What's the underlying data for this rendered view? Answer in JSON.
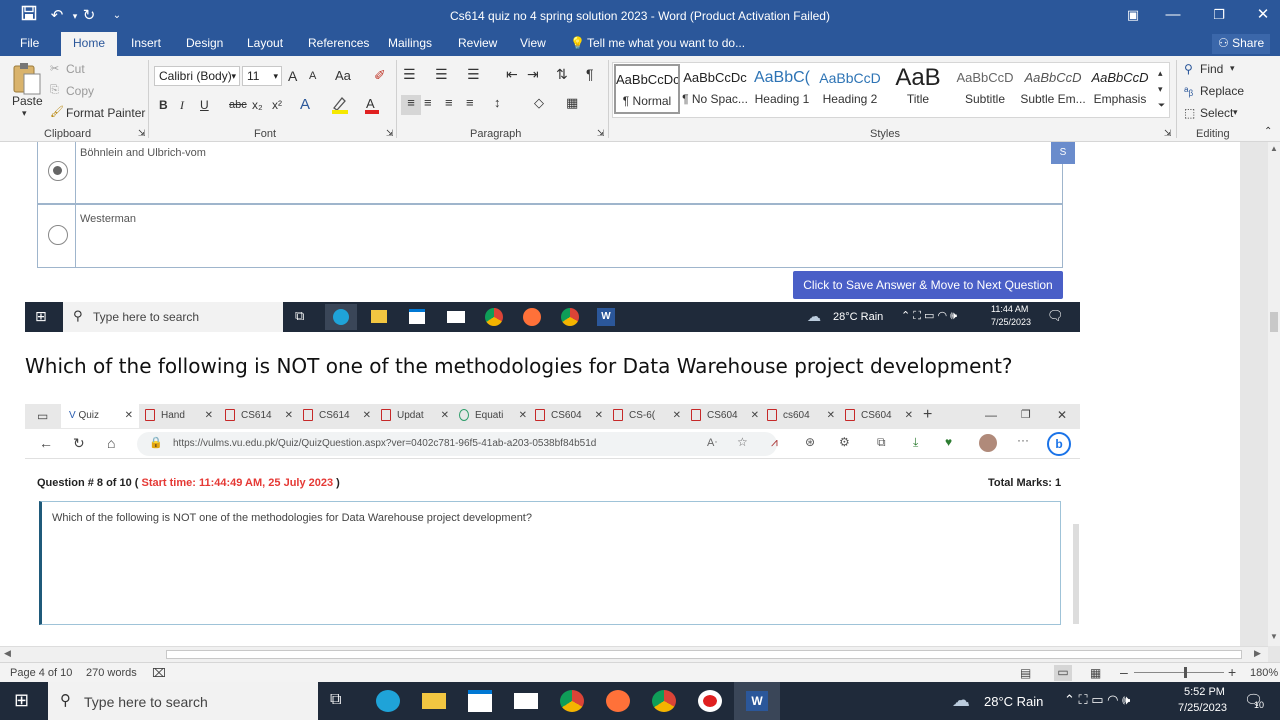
{
  "window": {
    "title": "Cs614 quiz no 4 spring solution 2023 - Word (Product Activation Failed)"
  },
  "ribbon_tabs": [
    "File",
    "Home",
    "Insert",
    "Design",
    "Layout",
    "References",
    "Mailings",
    "Review",
    "View"
  ],
  "tell_me": "Tell me what you want to do...",
  "share": "Share",
  "clipboard": {
    "paste": "Paste",
    "cut": "Cut",
    "copy": "Copy",
    "format_painter": "Format Painter",
    "label": "Clipboard"
  },
  "font": {
    "name": "Calibri (Body)",
    "size": "11",
    "label": "Font",
    "bold": "B",
    "italic": "I",
    "underline": "U",
    "strike": "abc",
    "sub": "x₂",
    "sup": "x²",
    "grow": "A",
    "shrink": "A",
    "case": "Aa"
  },
  "paragraph": {
    "label": "Paragraph"
  },
  "styles": {
    "label": "Styles",
    "items": [
      {
        "preview": "AaBbCcDc",
        "name": "¶ Normal"
      },
      {
        "preview": "AaBbCcDc",
        "name": "¶ No Spac..."
      },
      {
        "preview": "AaBbC(",
        "name": "Heading 1"
      },
      {
        "preview": "AaBbCcD",
        "name": "Heading 2"
      },
      {
        "preview": "AaB",
        "name": "Title"
      },
      {
        "preview": "AaBbCcD",
        "name": "Subtitle"
      },
      {
        "preview": "AaBbCcD",
        "name": "Subtle Em..."
      },
      {
        "preview": "AaBbCcD",
        "name": "Emphasis"
      }
    ]
  },
  "editing": {
    "find": "Find",
    "replace": "Replace",
    "select": "Select",
    "label": "Editing"
  },
  "shot1": {
    "options": [
      "Böhnlein and Ulbrich-vom",
      "Westerman"
    ],
    "save_button": "Click to Save Answer & Move to Next Question",
    "taskbar_search": "Type here to search",
    "weather": "28°C  Rain",
    "time": "11:44 AM",
    "date": "7/25/2023",
    "side_tab": "S"
  },
  "doc_heading": "Which of the following is NOT one of the methodologies for Data Warehouse project development?",
  "shot2": {
    "tabs": [
      "Quiz",
      "Hand",
      "CS614",
      "CS614",
      "Updat",
      "Equati",
      "CS604",
      "CS-6(",
      "CS604",
      "cs604",
      "CS604"
    ],
    "url": "https://vulms.vu.edu.pk/Quiz/QuizQuestion.aspx?ver=0402c781-96f5-41ab-a203-0538bf84b51d",
    "question_no": "Question # 8 of 10 (",
    "start_time": "Start time: 11:44:49 AM, 25 July 2023",
    "close_paren": ")",
    "total_marks": "Total Marks: 1",
    "question_text": "Which of the following is NOT one of the methodologies for Data Warehouse project development?"
  },
  "status": {
    "page": "Page 4 of 10",
    "words": "270 words",
    "zoom": "180%"
  },
  "taskbar": {
    "search": "Type here to search",
    "weather": "28°C  Rain",
    "time": "5:52 PM",
    "date": "7/25/2023",
    "notif": "10"
  },
  "colors": {
    "word_blue": "#2b579a",
    "start_time_red": "#e53935",
    "save_button": "#4a5fc7"
  }
}
